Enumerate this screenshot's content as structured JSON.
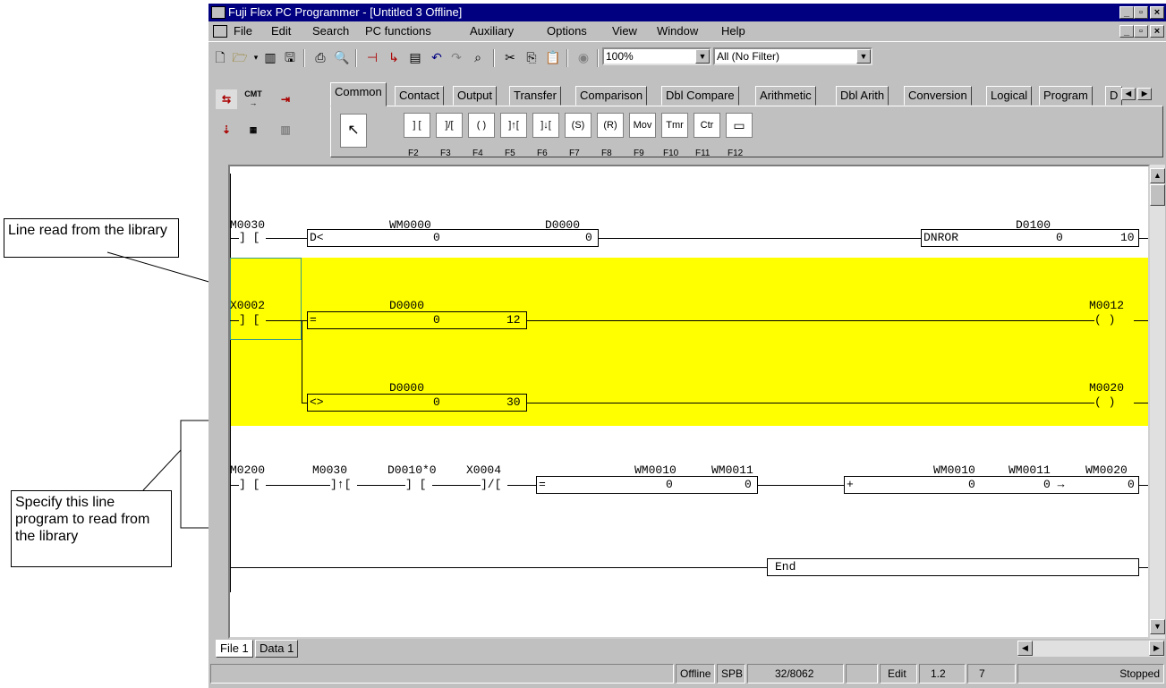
{
  "callouts": {
    "line_read": "Line read from the library",
    "specify_line": "Specify this line program to read from the library"
  },
  "window": {
    "title": "Fuji Flex PC Programmer - [Untitled 3 Offline]",
    "min_label": "_",
    "max_label": "▫",
    "close_label": "×"
  },
  "menu": {
    "items": [
      "File",
      "Edit",
      "Search",
      "PC functions",
      "Auxiliary",
      "Options",
      "View",
      "Window",
      "Help"
    ]
  },
  "toolbar": {
    "zoom": "100%",
    "filter": "All (No Filter)"
  },
  "tabs": [
    "Common",
    "Contact",
    "Output",
    "Transfer",
    "Comparison",
    "Dbl Compare",
    "Arithmetic",
    "Dbl Arith",
    "Conversion",
    "Logical",
    "Program",
    "D"
  ],
  "palette": {
    "buttons": [
      "] [",
      "]/[",
      "( )",
      "]↑[",
      "]↓[",
      "(S)",
      "(R)",
      "Mov",
      "Tmr",
      "Ctr",
      "▭"
    ],
    "fkeys": [
      "F2",
      "F3",
      "F4",
      "F5",
      "F6",
      "F7",
      "F8",
      "F9",
      "F10",
      "F11",
      "F12"
    ]
  },
  "ladder": {
    "rung1": {
      "contact": "M0030",
      "cmp_op": "D<",
      "cmp_a_label": "WM0000",
      "cmp_a": "0",
      "cmp_b_label": "D0000",
      "cmp_b": "0",
      "out_label": "D0100",
      "out_op": "DNROR",
      "out_a": "0",
      "out_b": "10"
    },
    "rung2": {
      "contact": "X0002",
      "cmp_label": "D0000",
      "cmp_op": "=",
      "cmp_a": "0",
      "cmp_b": "12",
      "coil": "M0012",
      "coil_sym": "(   )"
    },
    "rung3": {
      "cmp_label": "D0000",
      "cmp_op": "<>",
      "cmp_a": "0",
      "cmp_b": "30",
      "coil": "M0020",
      "coil_sym": "(   )"
    },
    "rung4": {
      "c1": "M0200",
      "c2": "M0030",
      "c3": "D0010*0",
      "c4": "X0004",
      "cmp_l1": "WM0010",
      "cmp_l2": "WM0011",
      "cmp_op": "=",
      "cmp_a": "0",
      "cmp_b": "0",
      "add_l1": "WM0010",
      "add_l2": "WM0011",
      "add_l3": "WM0020",
      "add_op": "+",
      "add_a": "0",
      "add_b": "0 →",
      "add_c": "0"
    },
    "end": "End"
  },
  "bottom_tabs": [
    "File 1",
    "Data 1"
  ],
  "status": {
    "mode": "Offline",
    "cpu": "SPB",
    "steps": "32/8062",
    "edit": "Edit",
    "version": "1.2",
    "num": "7",
    "run": "Stopped"
  },
  "colors": {
    "title_bar": "#000080",
    "highlight": "#ffff00",
    "selection_box": "#3a9a8a"
  }
}
